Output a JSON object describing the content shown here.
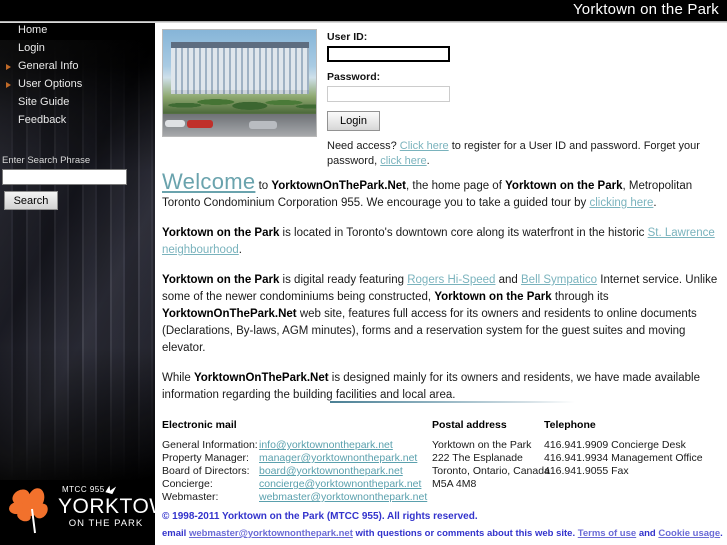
{
  "header": {
    "site_title": "Yorktown on the Park"
  },
  "sidebar": {
    "nav_items": [
      {
        "label": "Home",
        "arrow": false
      },
      {
        "label": "Login",
        "arrow": false
      },
      {
        "label": "General Info",
        "arrow": true
      },
      {
        "label": "User Options",
        "arrow": true
      },
      {
        "label": "Site Guide",
        "arrow": false
      },
      {
        "label": "Feedback",
        "arrow": false
      }
    ],
    "search": {
      "label": "Enter Search Phrase",
      "value": "",
      "placeholder": "",
      "button_label": "Search"
    },
    "logo": {
      "mtcc": "MTCC 955",
      "main": "YORKTOWN",
      "sub": "ON THE PARK",
      "leaf_color": "#f2712c"
    }
  },
  "login": {
    "userid_label": "User ID:",
    "userid_value": "",
    "password_label": "Password:",
    "password_value": "",
    "button_label": "Login",
    "need_access_prefix": "Need access? ",
    "need_access_link1": "Click here",
    "need_access_mid": " to register for a User ID and password. Forget your password, ",
    "need_access_link2": "click here",
    "need_access_suffix": "."
  },
  "body": {
    "welcome_word": "Welcome",
    "welcome_p1_a": " to ",
    "welcome_p1_b": "YorktownOnThePark.Net",
    "welcome_p1_c": ", the home page of ",
    "welcome_p1_d": "Yorktown on the Park",
    "welcome_p1_e": ", Metropolitan Toronto Condominium Corporation 955. We encourage you to take a guided tour by ",
    "welcome_p1_link": "clicking here",
    "welcome_p1_f": ".",
    "p2_a": "Yorktown on the Park",
    "p2_b": " is located in Toronto's downtown core along its waterfront in the historic ",
    "p2_link": "St. Lawrence neighbourhood",
    "p2_c": ".",
    "p3_a": "Yorktown on the Park",
    "p3_b": " is digital ready featuring ",
    "p3_link1": "Rogers Hi-Speed",
    "p3_c": " and ",
    "p3_link2": "Bell Sympatico",
    "p3_d": " Internet service. Unlike some of the newer condominiums being constructed, ",
    "p3_e": "Yorktown on the Park",
    "p3_f": " through its ",
    "p3_g": "YorktownOnThePark.Net",
    "p3_h": " web site, features full access for its owners and residents to online documents (Declarations, By-laws, AGM minutes), forms and a reservation system for the guest suites and moving elevator.",
    "p4_a": "While ",
    "p4_b": "YorktownOnThePark.Net",
    "p4_c": " is designed mainly for its owners and residents, we have made available information regarding the building facilities and local area."
  },
  "contact": {
    "email_heading": "Electronic mail",
    "postal_heading": "Postal address",
    "phone_heading": "Telephone",
    "emails": [
      {
        "label": "General Information:",
        "address": "info@yorktownonthepark.net"
      },
      {
        "label": "Property Manager:",
        "address": "manager@yorktownonthepark.net"
      },
      {
        "label": "Board of Directors:",
        "address": "board@yorktownonthepark.net"
      },
      {
        "label": "Concierge:",
        "address": "concierge@yorktownonthepark.net"
      },
      {
        "label": "Webmaster:",
        "address": "webmaster@yorktownonthepark.net"
      }
    ],
    "postal_lines": [
      "Yorktown on the Park",
      "222 The Esplanade",
      "Toronto, Ontario, Canada",
      "M5A 4M8"
    ],
    "phone_lines": [
      "416.941.9909 Concierge Desk",
      "416.941.9934 Management Office",
      "416.941.9055 Fax"
    ]
  },
  "footer": {
    "copyright": "© 1998-2011 Yorktown on the Park (MTCC 955). All rights reserved.",
    "email_prefix": "email ",
    "email_link": "webmaster@yorktownonthepark.net",
    "email_mid": " with questions or comments about this web site. ",
    "terms_link": "Terms of use",
    "and_text": " and ",
    "cookie_link": "Cookie usage",
    "email_suffix": "."
  }
}
